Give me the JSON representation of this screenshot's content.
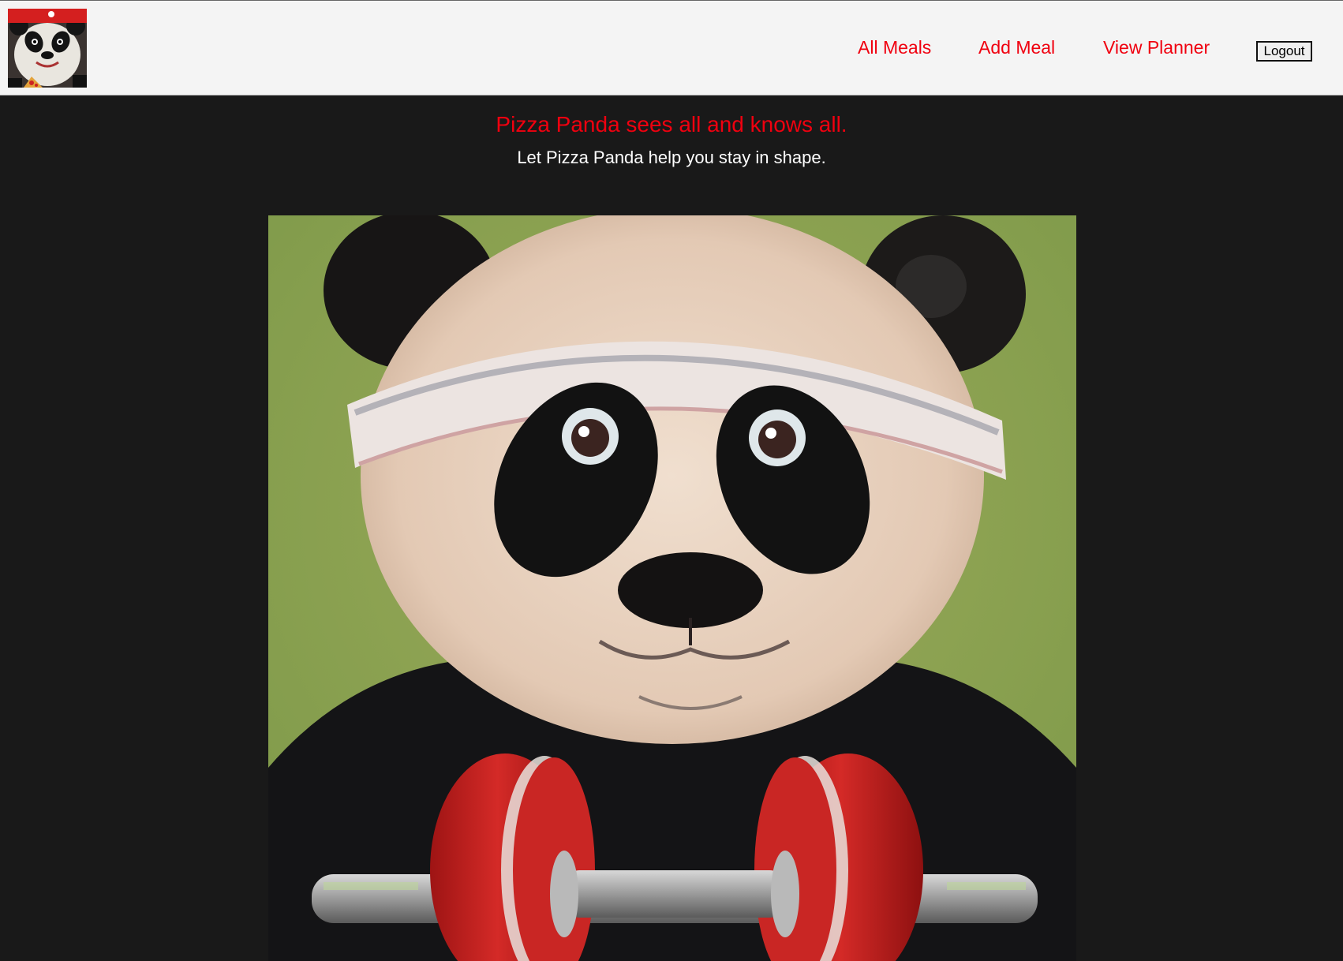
{
  "navbar": {
    "logo_alt": "Pizza Panda logo",
    "links": [
      {
        "label": "All Meals"
      },
      {
        "label": "Add Meal"
      },
      {
        "label": "View Planner"
      }
    ],
    "logout_label": "Logout"
  },
  "hero": {
    "title": "Pizza Panda sees all and knows all.",
    "subtitle": "Let Pizza Panda help you stay in shape.",
    "image_alt": "Painting of a panda wearing a headband lifting a red dumbbell"
  },
  "colors": {
    "accent": "#f0000f",
    "page_background": "#191919",
    "navbar_background": "#f4f4f4"
  }
}
